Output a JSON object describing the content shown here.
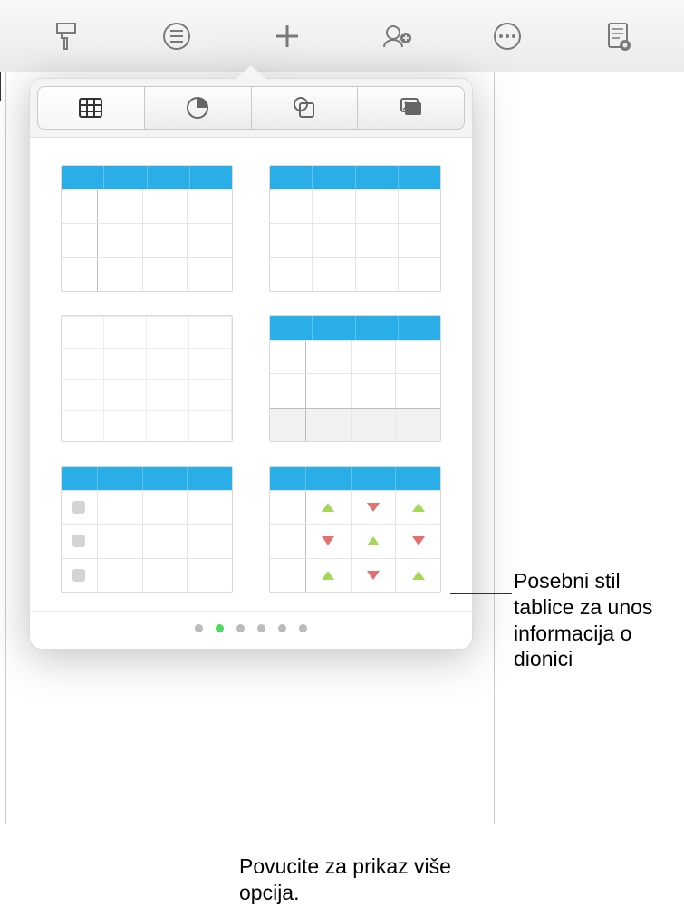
{
  "toolbar": {
    "format_icon": "format-brush-icon",
    "bullets_icon": "list-bullets-icon",
    "insert_icon": "plus-icon",
    "collaborate_icon": "collaborate-icon",
    "more_icon": "more-icon",
    "document_icon": "document-settings-icon"
  },
  "popover": {
    "tabs": {
      "table": "table-tab",
      "chart": "chart-tab",
      "shape": "shape-tab",
      "media": "media-tab"
    },
    "active_tab": "table",
    "table_styles": [
      {
        "id": "style1",
        "desc": "Blue header with row header column"
      },
      {
        "id": "style2",
        "desc": "Blue header plain"
      },
      {
        "id": "style3",
        "desc": "Plain no header"
      },
      {
        "id": "style4",
        "desc": "Blue header with footer row"
      },
      {
        "id": "style5",
        "desc": "Blue header checklist"
      },
      {
        "id": "style6",
        "desc": "Blue header stock triangles"
      }
    ],
    "page_dots": {
      "count": 6,
      "active_index": 1
    }
  },
  "callouts": {
    "stock_style": "Posebni stil tablice za unos informacija o dionici",
    "swipe_hint": "Povucite za prikaz više opcija."
  }
}
